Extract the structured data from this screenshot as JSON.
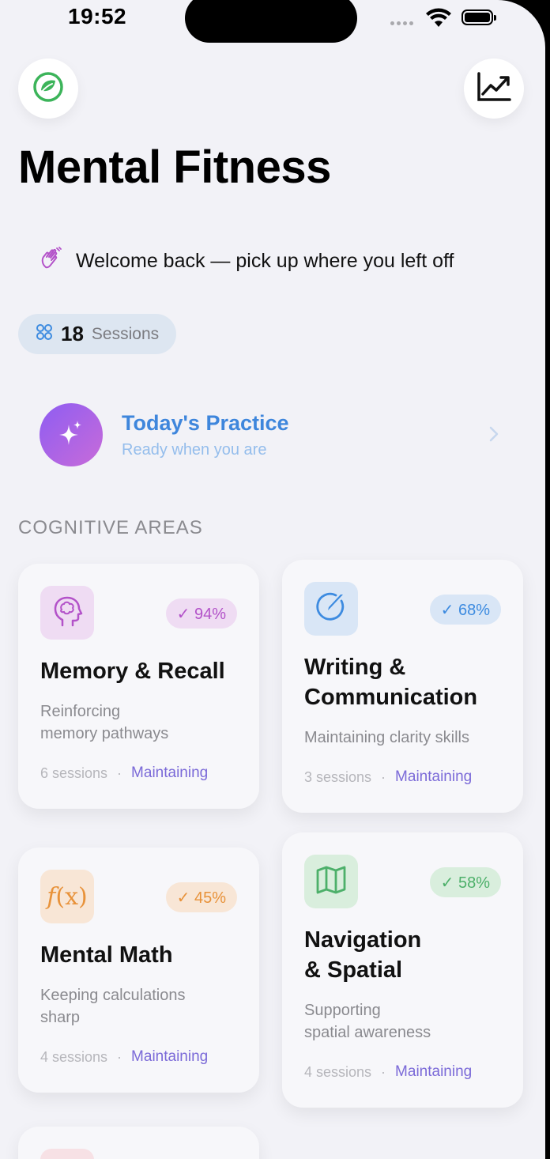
{
  "status_bar": {
    "time": "19:52"
  },
  "header": {
    "leaf_icon": "leaf-icon",
    "chart_icon": "chart-trend-icon",
    "title": "Mental Fitness"
  },
  "welcome": {
    "icon": "waving-hand-icon",
    "text": "Welcome back — pick up where you left off"
  },
  "sessions": {
    "icon": "grid-dots-icon",
    "count": "18",
    "label": "Sessions"
  },
  "practice": {
    "icon": "sparkles-icon",
    "title": "Today's Practice",
    "subtitle": "Ready when you are"
  },
  "section_title": "COGNITIVE AREAS",
  "cards": [
    {
      "title": "Memory & Recall",
      "description_lines": [
        "Reinforcing",
        "memory pathways"
      ],
      "badge": "✓ 94%",
      "sessions": "6 sessions",
      "status": "Maintaining",
      "icon": "brain-head-icon",
      "color": "#b352c9"
    },
    {
      "title_lines": [
        "Writing &",
        "Communication"
      ],
      "description": "Maintaining clarity skills",
      "badge": "✓ 68%",
      "sessions": "3 sessions",
      "status": "Maintaining",
      "icon": "pen-circle-icon",
      "color": "#3d8be0"
    },
    {
      "title": "Mental Math",
      "description_lines": [
        "Keeping calculations",
        "sharp"
      ],
      "badge": "✓ 45%",
      "sessions": "4 sessions",
      "status": "Maintaining",
      "icon": "function-icon",
      "color": "#e8923a"
    },
    {
      "title_lines": [
        "Navigation",
        "& Spatial"
      ],
      "description_lines": [
        "Supporting",
        "spatial awareness"
      ],
      "badge": "✓ 58%",
      "sessions": "4 sessions",
      "status": "Maintaining",
      "icon": "map-icon",
      "color": "#4db06a"
    }
  ]
}
